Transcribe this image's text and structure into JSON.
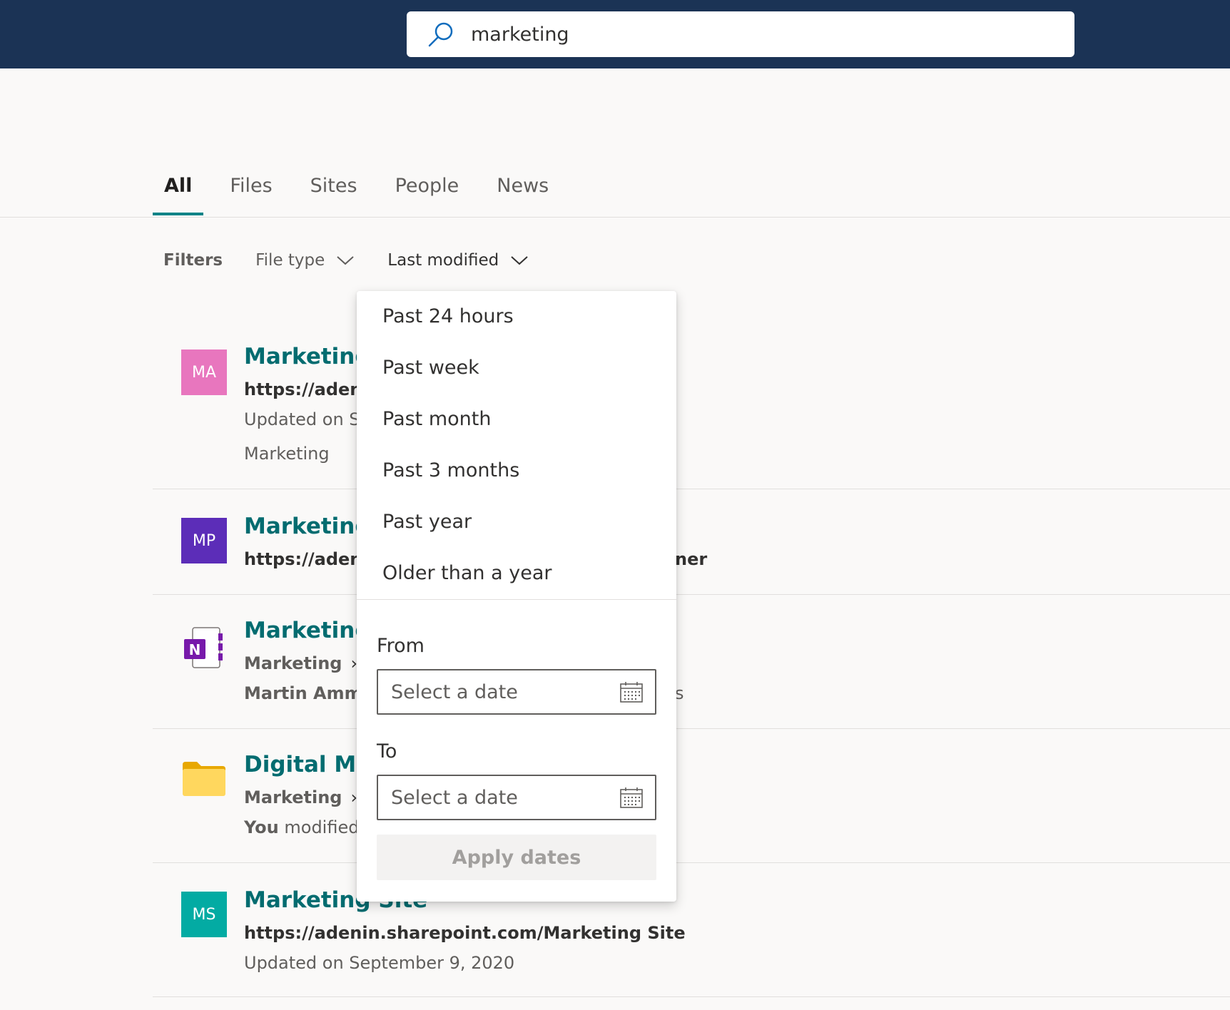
{
  "search": {
    "value": "marketing"
  },
  "tabs": [
    {
      "label": "All",
      "active": true
    },
    {
      "label": "Files"
    },
    {
      "label": "Sites"
    },
    {
      "label": "People"
    },
    {
      "label": "News"
    }
  ],
  "filters": {
    "label": "Filters",
    "file_type": "File type",
    "last_modified": "Last modified"
  },
  "results": [
    {
      "initials": "MA",
      "color": "#e876be",
      "title": "Marketing",
      "line1": "https://adenin",
      "line2": "Updated on S",
      "line3": "Marketing"
    },
    {
      "initials": "MP",
      "color": "#5c2db8",
      "title": "Marketing",
      "line1": "https://adenin",
      "line1_tail": "ner"
    },
    {
      "icon": "onenote-icon",
      "title": "Marketing",
      "line1": "Marketing",
      "line2": "Martin Amm",
      "line2_tail": "s"
    },
    {
      "icon": "folder-icon",
      "title": "Digital Mar",
      "line1": "Marketing",
      "line2_bold": "You",
      "line2": " modified"
    },
    {
      "initials": "MS",
      "color": "#03aba3",
      "title": "Marketing Site",
      "line1": "https://adenin.sharepoint.com/Marketing Site",
      "line2": "Updated on September 9, 2020"
    }
  ],
  "last_modified_menu": {
    "options": [
      "Past 24 hours",
      "Past week",
      "Past month",
      "Past 3 months",
      "Past year",
      "Older than a year"
    ],
    "from_label": "From",
    "to_label": "To",
    "date_placeholder": "Select a date",
    "apply_label": "Apply dates"
  },
  "colors": {
    "header": "#1b3355",
    "accent": "#038387",
    "link": "#036c70"
  }
}
